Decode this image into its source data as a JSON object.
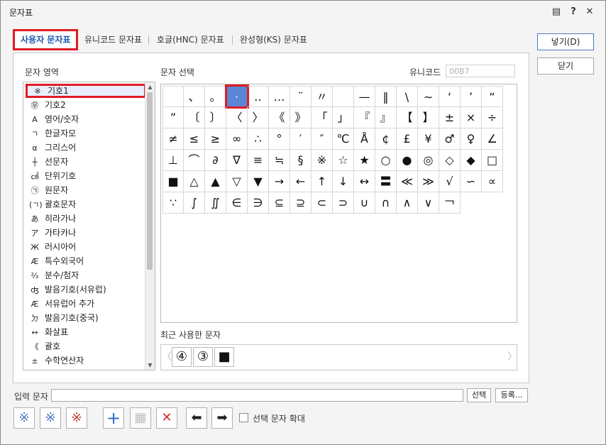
{
  "window": {
    "title": "문자표"
  },
  "titlebar_buttons": [
    "▤",
    "?",
    "✕"
  ],
  "tabs": [
    "사용자 문자표",
    "유니코드 문자표",
    "호글(HNC) 문자표",
    "완성형(KS) 문자표"
  ],
  "buttons": {
    "insert": "넣기(D)",
    "close": "닫기",
    "select": "선택",
    "register": "등록..."
  },
  "labels": {
    "area": "문자 영역",
    "select": "문자 선택",
    "unicode": "유니코드",
    "recent": "최근 사용한 문자",
    "input": "입력 문자",
    "enlarge": "선택 문자 확대"
  },
  "unicode_value": "00B7",
  "categories": [
    {
      "icon": "※",
      "label": "기호1",
      "selected": true
    },
    {
      "icon": "㉾",
      "label": "기호2"
    },
    {
      "icon": "A",
      "label": "영어/숫자"
    },
    {
      "icon": "ㄱ",
      "label": "한글자모"
    },
    {
      "icon": "α",
      "label": "그리스어"
    },
    {
      "icon": "┼",
      "label": "선문자"
    },
    {
      "icon": "㎠",
      "label": "단위기호"
    },
    {
      "icon": "㉠",
      "label": "원문자"
    },
    {
      "icon": "(ㄱ)",
      "label": "괄호문자"
    },
    {
      "icon": "あ",
      "label": "히라가나"
    },
    {
      "icon": "ア",
      "label": "가타카나"
    },
    {
      "icon": "Ж",
      "label": "러시아어"
    },
    {
      "icon": "Æ",
      "label": "특수외국어"
    },
    {
      "icon": "⅔",
      "label": "분수/첨자"
    },
    {
      "icon": "ʤ",
      "label": "발음기호(서유럽)"
    },
    {
      "icon": "Æ",
      "label": "서유럽어 추가"
    },
    {
      "icon": "ㄉ",
      "label": "발음기호(중국)"
    },
    {
      "icon": "↔",
      "label": "화살표"
    },
    {
      "icon": "《",
      "label": "괄호"
    },
    {
      "icon": "±",
      "label": "수학연산자"
    }
  ],
  "symbols": [
    "",
    "、",
    "。",
    "·",
    "‥",
    "…",
    "¨",
    "〃",
    "",
    "—",
    "‖",
    "\\",
    "∼",
    "‘",
    "’",
    "“",
    "”",
    "〔",
    "〕",
    "〈",
    "〉",
    "《",
    "》",
    "「",
    "」",
    "『",
    "』",
    "【",
    "】",
    "±",
    "×",
    "÷",
    "≠",
    "≤",
    "≥",
    "∞",
    "∴",
    "°",
    "′",
    "″",
    "℃",
    "Å",
    "¢",
    "£",
    "¥",
    "♂",
    "♀",
    "∠",
    "⊥",
    "⌒",
    "∂",
    "∇",
    "≡",
    "≒",
    "§",
    "※",
    "☆",
    "★",
    "○",
    "●",
    "◎",
    "◇",
    "◆",
    "□",
    "■",
    "△",
    "▲",
    "▽",
    "▼",
    "→",
    "←",
    "↑",
    "↓",
    "↔",
    "〓",
    "≪",
    "≫",
    "√",
    "∽",
    "∝",
    "∵",
    "∫",
    "∬",
    "∈",
    "∋",
    "⊆",
    "⊇",
    "⊂",
    "⊃",
    "∪",
    "∩",
    "∧",
    "∨",
    "￢"
  ],
  "selected_symbol_index": 3,
  "recent": [
    "④",
    "③",
    "■"
  ],
  "toolbar_icons": [
    "add-char",
    "edit-char",
    "delete-char",
    "add-group",
    "table-add",
    "delete-group",
    "move-left",
    "move-right"
  ],
  "toolbar_glyphs": [
    "※",
    "※",
    "※",
    "+",
    "▦",
    "✕",
    "⬅",
    "➡"
  ]
}
